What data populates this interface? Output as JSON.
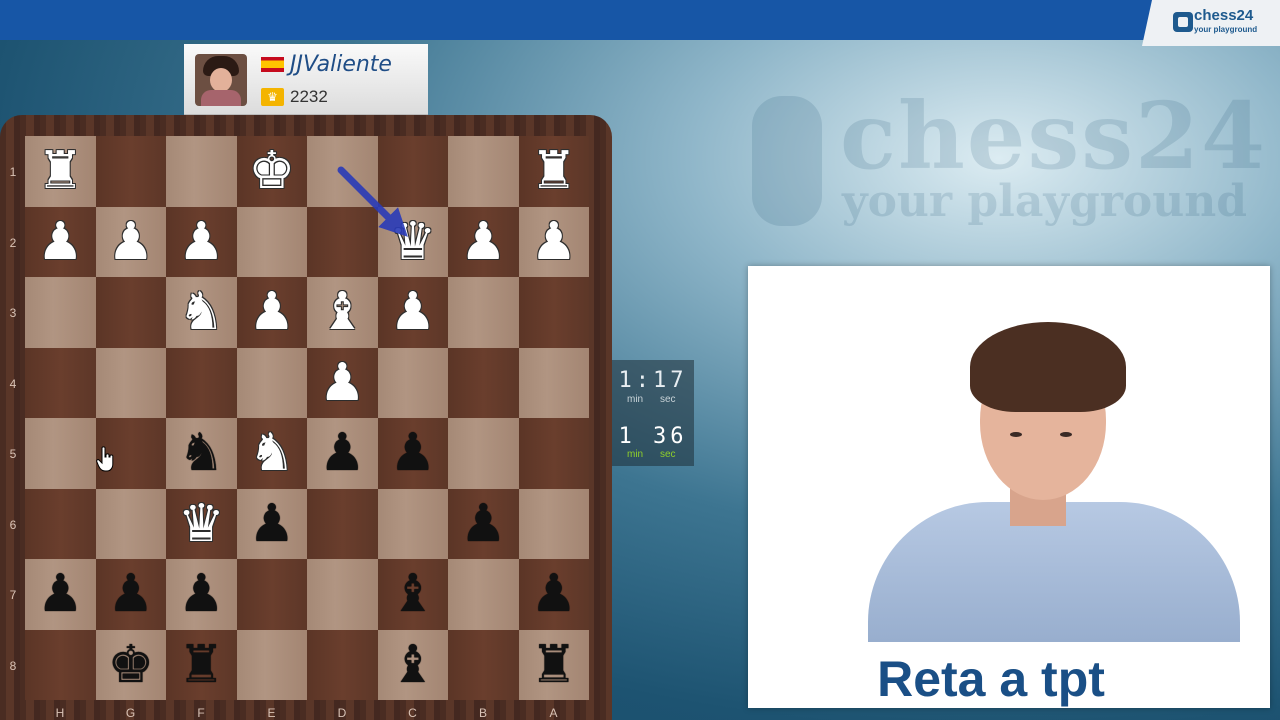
{
  "logo": {
    "name": "chess24",
    "tagline": "your playground",
    "watermark_name": "chess24",
    "watermark_tagline": "your playground"
  },
  "player": {
    "name": "JJValiente",
    "rating": "2232",
    "flag": "spain"
  },
  "board": {
    "rank_labels": [
      "1",
      "2",
      "3",
      "4",
      "5",
      "6",
      "7",
      "8"
    ],
    "file_labels": [
      "H",
      "G",
      "F",
      "E",
      "D",
      "C",
      "B",
      "A"
    ],
    "squares": [
      [
        "wR",
        "",
        "",
        "wK",
        "",
        "",
        "",
        "wR"
      ],
      [
        "wP",
        "wP",
        "wP",
        "",
        "",
        "wQ",
        "wP",
        "wP"
      ],
      [
        "",
        "",
        "wN",
        "wP",
        "wB",
        "wP",
        "",
        ""
      ],
      [
        "",
        "",
        "",
        "",
        "wP",
        "",
        "",
        ""
      ],
      [
        "",
        "",
        "bN",
        "wN",
        "bP",
        "bP",
        "",
        ""
      ],
      [
        "",
        "",
        "wQ",
        "bP",
        "",
        "",
        "bP",
        ""
      ],
      [
        "bP",
        "bP",
        "bP",
        "",
        "",
        "bB",
        "",
        "bP"
      ],
      [
        "",
        "bK",
        "bR",
        "",
        "",
        "bB",
        "",
        "bR"
      ]
    ],
    "colors": {
      "light": "#b19582",
      "dark": "#6a3e2d",
      "arrow": "#2a3bb8"
    }
  },
  "clocks": [
    {
      "min": "1",
      "sec": "17",
      "min_label": "min",
      "sec_label": "sec",
      "active": false
    },
    {
      "min": "1",
      "sec": "36",
      "min_label": "min",
      "sec_label": "sec",
      "active": true
    }
  ],
  "video": {
    "caption": "Reta a tpt"
  },
  "colors": {
    "topbar": "#1756a6",
    "caption": "#1a4f86",
    "active_clock": "#8fd02a"
  }
}
